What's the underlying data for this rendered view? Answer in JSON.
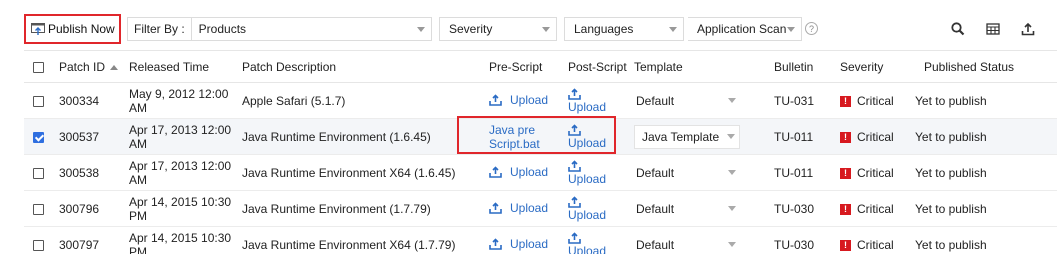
{
  "toolbar": {
    "publish_label": "Publish Now",
    "filter_label": "Filter By :",
    "filter_value": "Products",
    "severity_label": "Severity",
    "languages_label": "Languages",
    "appscan_label": "Application Scan Statu",
    "help_symbol": "?",
    "icons": [
      "publish-icon",
      "search-icon",
      "columns-icon",
      "export-icon"
    ]
  },
  "table": {
    "headers": {
      "patch_id": "Patch ID",
      "released_time": "Released Time",
      "patch_description": "Patch Description",
      "pre_script": "Pre-Script",
      "post_script": "Post-Script",
      "template": "Template",
      "bulletin": "Bulletin",
      "severity": "Severity",
      "published_status": "Published Status"
    },
    "rows": [
      {
        "checked": false,
        "patch_id": "300334",
        "released_time": "May 9, 2012 12:00 AM",
        "description": "Apple Safari (5.1.7)",
        "pre_script": "Upload",
        "post_script": "Upload",
        "template": "Default",
        "bulletin": "TU-031",
        "severity": "Critical",
        "status": "Yet to publish"
      },
      {
        "checked": true,
        "patch_id": "300537",
        "released_time": "Apr 17, 2013 12:00 AM",
        "description": "Java Runtime Environment (1.6.45)",
        "pre_script": "Java pre Script.bat",
        "post_script": "Upload",
        "template": "Java Template",
        "bulletin": "TU-011",
        "severity": "Critical",
        "status": "Yet to publish"
      },
      {
        "checked": false,
        "patch_id": "300538",
        "released_time": "Apr 17, 2013 12:00 AM",
        "description": "Java Runtime Environment X64 (1.6.45)",
        "pre_script": "Upload",
        "post_script": "Upload",
        "template": "Default",
        "bulletin": "TU-011",
        "severity": "Critical",
        "status": "Yet to publish"
      },
      {
        "checked": false,
        "patch_id": "300796",
        "released_time": "Apr 14, 2015 10:30 PM",
        "description": "Java Runtime Environment (1.7.79)",
        "pre_script": "Upload",
        "post_script": "Upload",
        "template": "Default",
        "bulletin": "TU-030",
        "severity": "Critical",
        "status": "Yet to publish"
      },
      {
        "checked": false,
        "patch_id": "300797",
        "released_time": "Apr 14, 2015 10:30 PM",
        "description": "Java Runtime Environment X64 (1.7.79)",
        "pre_script": "Upload",
        "post_script": "Upload",
        "template": "Default",
        "bulletin": "TU-030",
        "severity": "Critical",
        "status": "Yet to publish"
      }
    ]
  },
  "colors": {
    "highlight": "#e0262b",
    "link": "#2a6bc4",
    "critical": "#d7191f",
    "checkbox_checked": "#2f6fe0"
  }
}
